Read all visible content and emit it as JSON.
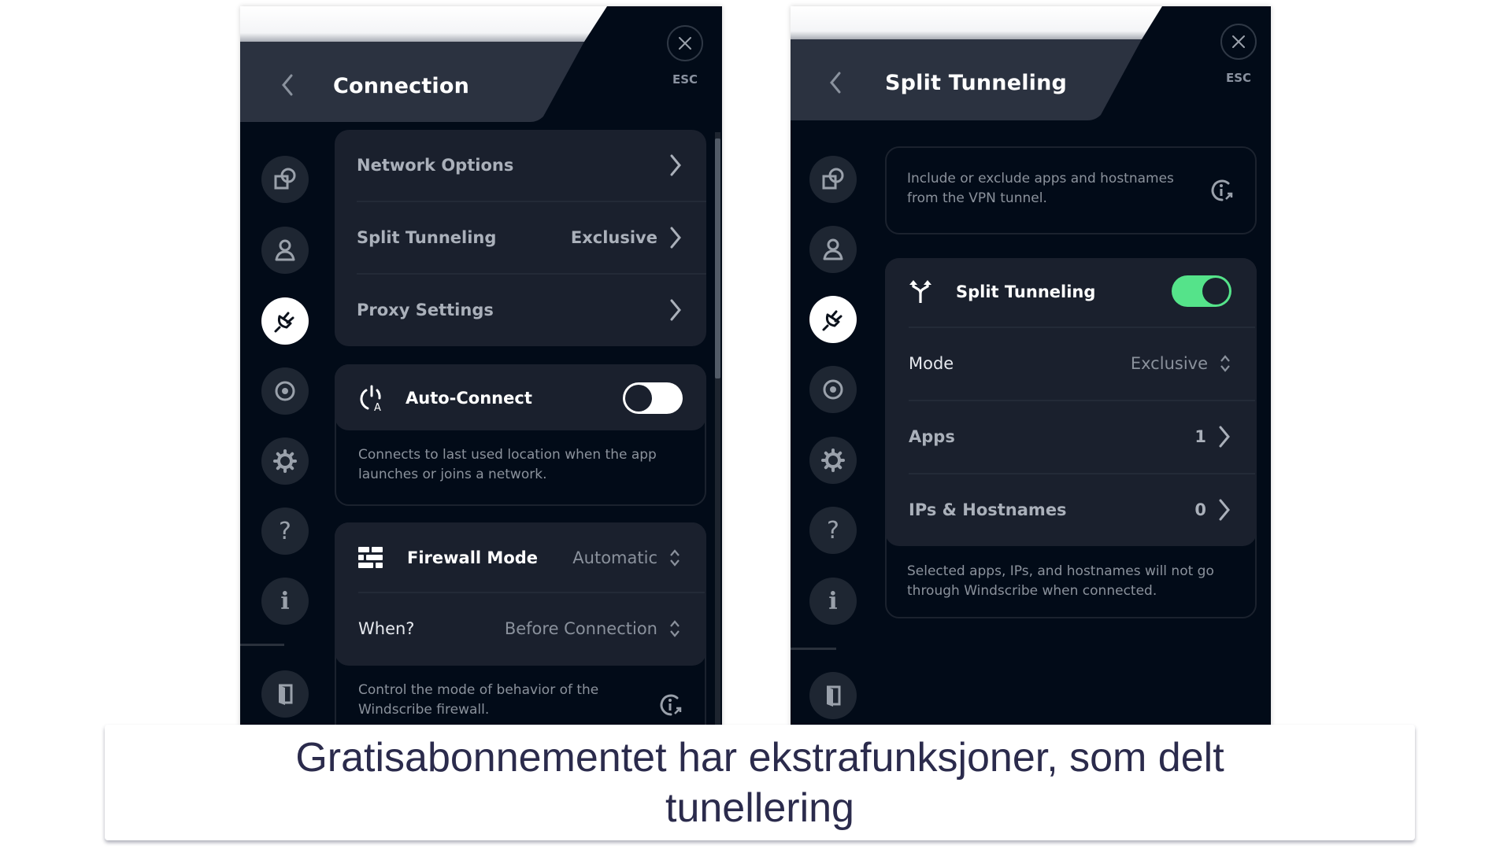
{
  "left_panel": {
    "title": "Connection",
    "esc_label": "ESC",
    "menu_items": [
      {
        "label": "Network Options",
        "value": ""
      },
      {
        "label": "Split Tunneling",
        "value": "Exclusive"
      },
      {
        "label": "Proxy Settings",
        "value": ""
      }
    ],
    "auto_connect": {
      "label": "Auto-Connect",
      "enabled": false,
      "description_line1": "Connects to last used location when the app",
      "description_line2": "launches or joins a network."
    },
    "firewall": {
      "label": "Firewall Mode",
      "value": "Automatic",
      "when_label": "When?",
      "when_value": "Before Connection",
      "description_line1": "Control the mode of behavior of the",
      "description_line2": "Windscribe firewall."
    }
  },
  "right_panel": {
    "title": "Split Tunneling",
    "esc_label": "ESC",
    "info_line1": "Include or exclude apps and hostnames",
    "info_line2": "from the VPN tunnel.",
    "split_tunneling": {
      "label": "Split Tunneling",
      "enabled": true,
      "mode_label": "Mode",
      "mode_value": "Exclusive",
      "apps_label": "Apps",
      "apps_count": "1",
      "ips_label": "IPs & Hostnames",
      "ips_count": "0",
      "description_line1": "Selected apps, IPs, and hostnames will not go",
      "description_line2": "through Windscribe when connected."
    }
  },
  "sidebar_icons": [
    "connection-window-icon",
    "account-icon",
    "connection-plug-icon",
    "robert-icon",
    "general-settings-icon",
    "help-icon",
    "about-icon",
    "logout-door-icon"
  ],
  "colors": {
    "panel_bg": "#020b18",
    "header_bg": "#2b3240",
    "card_bg": "#1a202d",
    "toggle_on": "#55e38a",
    "caption_text": "#2b2b4c"
  },
  "caption": "Gratisabonnementet har ekstrafunksjoner, som delt tunellering"
}
